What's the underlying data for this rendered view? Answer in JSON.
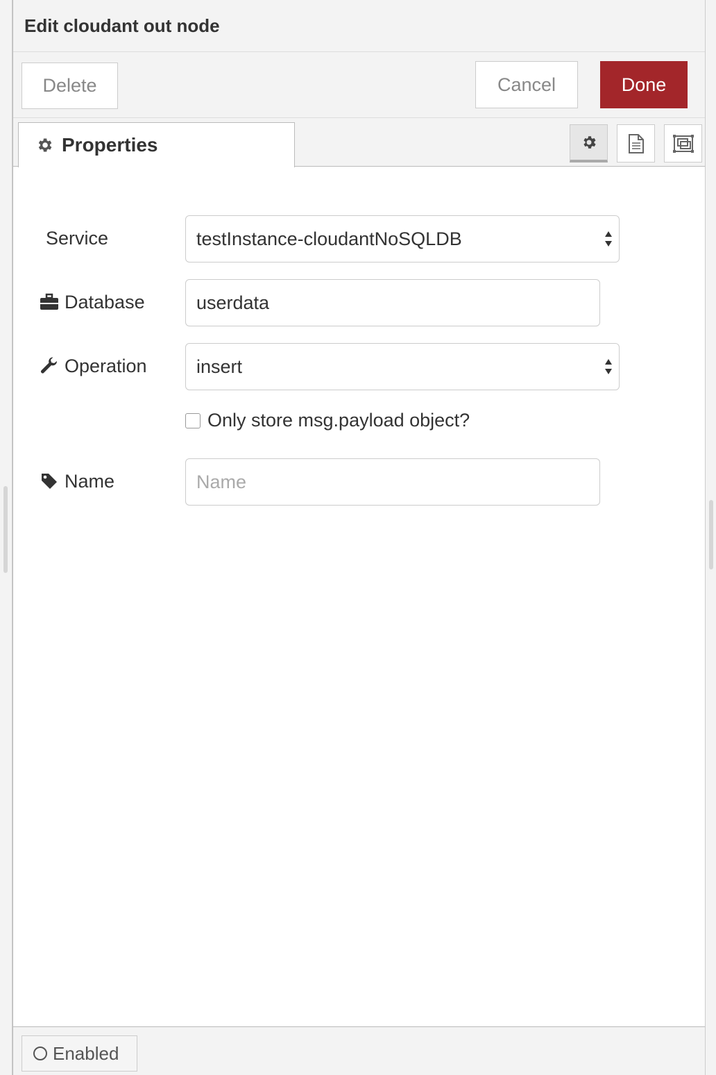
{
  "header": {
    "title": "Edit cloudant out node"
  },
  "toolbar": {
    "delete_label": "Delete",
    "cancel_label": "Cancel",
    "done_label": "Done",
    "done_color": "#a3262a"
  },
  "tabs": {
    "properties_label": "Properties",
    "icons": [
      "gear-icon",
      "description-icon",
      "appearance-icon"
    ]
  },
  "form": {
    "service": {
      "label": "Service",
      "value": "testInstance-cloudantNoSQLDB"
    },
    "database": {
      "label": "Database",
      "value": "userdata"
    },
    "operation": {
      "label": "Operation",
      "value": "insert"
    },
    "payload_only": {
      "label": "Only store msg.payload object?",
      "checked": false
    },
    "name": {
      "label": "Name",
      "value": "",
      "placeholder": "Name"
    }
  },
  "footer": {
    "enabled_label": "Enabled"
  }
}
